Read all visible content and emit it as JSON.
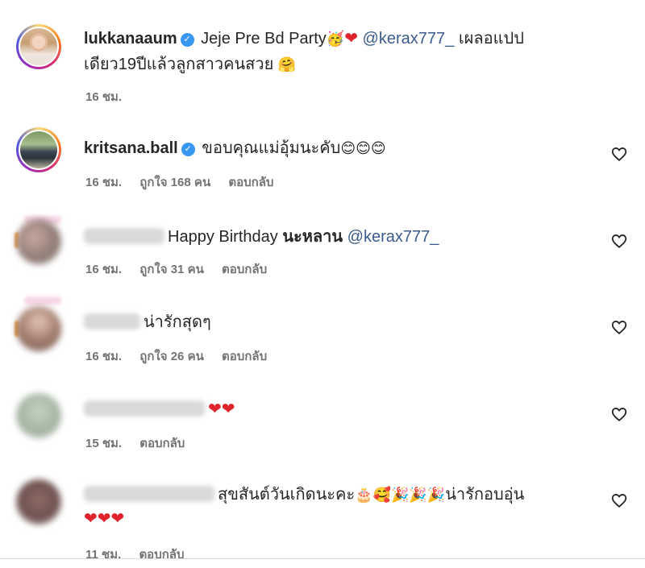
{
  "post_caption": {
    "username": "lukkanaaum",
    "text_a": "Jeje Pre Bd Party",
    "emoji_a": "🥳",
    "heart": "❤",
    "mention": "@kerax777_",
    "text_b": "เผลอแปป",
    "text_line2": "เดียว19ปีแล้วลูกสาวคนสวย",
    "emoji_b": "🤗",
    "time": "16 ชม."
  },
  "comments": [
    {
      "username": "kritsana.ball",
      "text": "ขอบคุณแม่อุ้มนะคับ",
      "emojis": "😊😊😊",
      "time": "16 ชม.",
      "likes": "ถูกใจ 168 คน",
      "reply": "ตอบกลับ"
    },
    {
      "text": "Happy Birthday",
      "text_thai": "นะหลาน",
      "mention": "@kerax777_",
      "time": "16 ชม.",
      "likes": "ถูกใจ 31 คน",
      "reply": "ตอบกลับ"
    },
    {
      "text": "น่ารักสุดๆ",
      "time": "16 ชม.",
      "likes": "ถูกใจ 26 คน",
      "reply": "ตอบกลับ"
    },
    {
      "hearts": "❤❤",
      "time": "15 ชม.",
      "reply": "ตอบกลับ"
    },
    {
      "text": "สุขสันต์วันเกิดนะคะ",
      "emojis": "🎂🥰🎉🎉🎉",
      "text_end": "น่ารักอบอุ่น",
      "hearts": "❤❤❤",
      "time": "11 ชม.",
      "reply": "ตอบกลับ"
    }
  ],
  "icons": {
    "like": "heart-outline-icon",
    "verified": "verified-badge-icon"
  },
  "colors": {
    "mention": "#3b5b8c",
    "verified": "#3897f0",
    "meta": "#737373",
    "heart": "#e0242e"
  }
}
